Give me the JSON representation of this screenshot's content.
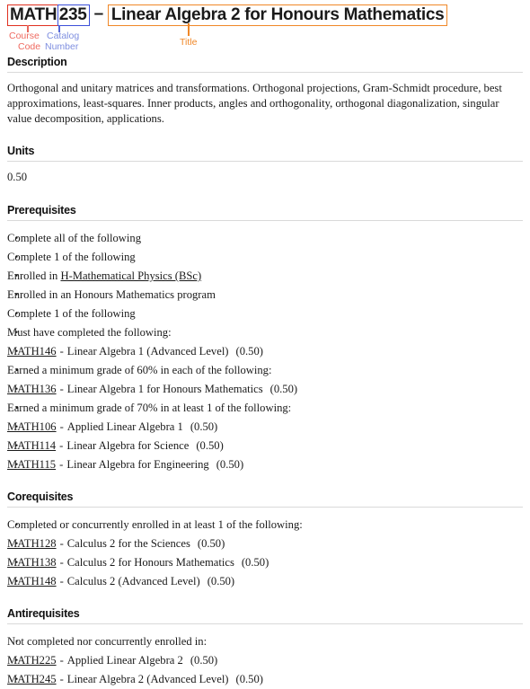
{
  "header": {
    "course_code": "MATH",
    "catalog_number": "235",
    "separator": "–",
    "title": "Linear Algebra 2 for Honours Mathematics",
    "annotations": {
      "course_code_line1": "Course",
      "course_code_line2": "Code",
      "catalog_line1": "Catalog",
      "catalog_line2": "Number",
      "title_label": "Title"
    },
    "colors": {
      "course_code_box": "#e03020",
      "catalog_box": "#3b4fd8",
      "title_box": "#f08828",
      "course_code_label": "#ef6a60",
      "catalog_label": "#7f8fe0",
      "title_label": "#f08828"
    }
  },
  "sections": {
    "description": {
      "heading": "Description",
      "text": "Orthogonal and unitary matrices and transformations. Orthogonal projections, Gram-Schmidt procedure, best approximations, least-squares. Inner products, angles and orthogonality, orthogonal diagonalization, singular value decomposition, applications."
    },
    "units": {
      "heading": "Units",
      "value": "0.50"
    },
    "prerequisites": {
      "heading": "Prerequisites",
      "root": "Complete all of the following",
      "group1": {
        "label": "Complete 1 of the following",
        "items": [
          {
            "prefix": "Enrolled in ",
            "link": "H-Mathematical Physics (BSc)",
            "suffix": ""
          },
          {
            "prefix": "Enrolled in an Honours Mathematics program",
            "link": "",
            "suffix": ""
          }
        ]
      },
      "group2": {
        "label": "Complete 1 of the following",
        "subgroups": [
          {
            "label": "Must have completed the following:",
            "courses": [
              {
                "code": "MATH146",
                "dash": "-",
                "title": "Linear Algebra 1 (Advanced Level)",
                "units": "(0.50)"
              }
            ]
          },
          {
            "label": "Earned a minimum grade of 60% in each of the following:",
            "courses": [
              {
                "code": "MATH136",
                "dash": "-",
                "title": "Linear Algebra 1 for Honours Mathematics",
                "units": "(0.50)"
              }
            ]
          },
          {
            "label": "Earned a minimum grade of 70% in at least 1 of the following:",
            "courses": [
              {
                "code": "MATH106",
                "dash": "-",
                "title": "Applied Linear Algebra 1",
                "units": "(0.50)"
              },
              {
                "code": "MATH114",
                "dash": "-",
                "title": "Linear Algebra for Science",
                "units": "(0.50)"
              },
              {
                "code": "MATH115",
                "dash": "-",
                "title": "Linear Algebra for Engineering",
                "units": "(0.50)"
              }
            ]
          }
        ]
      }
    },
    "corequisites": {
      "heading": "Corequisites",
      "label": "Completed or concurrently enrolled in at least 1 of the following:",
      "courses": [
        {
          "code": "MATH128",
          "dash": "-",
          "title": "Calculus 2 for the Sciences",
          "units": "(0.50)"
        },
        {
          "code": "MATH138",
          "dash": "-",
          "title": "Calculus 2 for Honours Mathematics",
          "units": "(0.50)"
        },
        {
          "code": "MATH148",
          "dash": "-",
          "title": "Calculus 2 (Advanced Level)",
          "units": "(0.50)"
        }
      ]
    },
    "antirequisites": {
      "heading": "Antirequisites",
      "label": "Not completed nor concurrently enrolled in:",
      "courses": [
        {
          "code": "MATH225",
          "dash": "-",
          "title": "Applied Linear Algebra 2",
          "units": "(0.50)"
        },
        {
          "code": "MATH245",
          "dash": "-",
          "title": "Linear Algebra 2 (Advanced Level)",
          "units": "(0.50)"
        }
      ]
    }
  }
}
